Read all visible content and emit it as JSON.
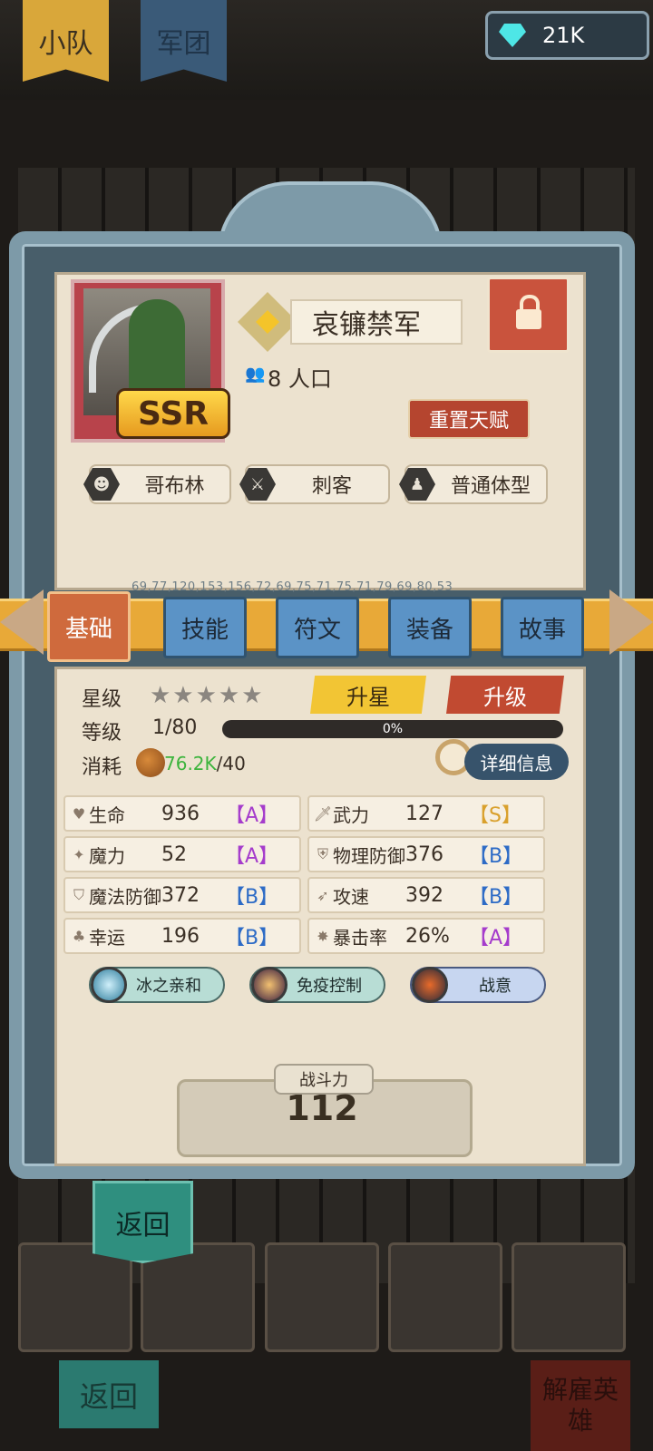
{
  "topbar": {
    "tabs": [
      {
        "label": "小队"
      },
      {
        "label": "军团"
      }
    ],
    "currency": {
      "icon": "diamond-icon",
      "amount": "21K"
    }
  },
  "hero": {
    "name": "哀镰禁军",
    "rarity": "SSR",
    "population": "8 人口",
    "reset_label": "重置天赋",
    "tags": [
      {
        "icon": "goblin-icon",
        "label": "哥布林"
      },
      {
        "icon": "crossed-swords-icon",
        "label": "刺客"
      },
      {
        "icon": "body-icon",
        "label": "普通体型"
      }
    ]
  },
  "faint_text": "69,77,120,153,156,72,69,75,71,75,71,79,69,80,53",
  "tabs": [
    {
      "label": "基础",
      "active": true
    },
    {
      "label": "技能"
    },
    {
      "label": "符文"
    },
    {
      "label": "装备"
    },
    {
      "label": "故事"
    }
  ],
  "basic": {
    "star_label": "星级",
    "stars": "★★★★★",
    "star_up_label": "升星",
    "level_up_label": "升级",
    "level_label": "等级",
    "level_value": "1/80",
    "xp_percent": "0%",
    "xp_fraction": 0,
    "cost_label": "消耗",
    "cost_have": "76.2K",
    "cost_need": "/40",
    "detail_label": "详细信息"
  },
  "stats": [
    {
      "icon": "heart-icon",
      "name": "生命",
      "value": "936",
      "grade": "【A】"
    },
    {
      "icon": "sword-icon",
      "name": "武力",
      "value": "127",
      "grade": "【S】"
    },
    {
      "icon": "magic-icon",
      "name": "魔力",
      "value": "52",
      "grade": "【A】"
    },
    {
      "icon": "shield-icon",
      "name": "物理防御",
      "value": "376",
      "grade": "【B】"
    },
    {
      "icon": "magic-shield-icon",
      "name": "魔法防御",
      "value": "372",
      "grade": "【B】"
    },
    {
      "icon": "boot-icon",
      "name": "攻速",
      "value": "392",
      "grade": "【B】"
    },
    {
      "icon": "clover-icon",
      "name": "幸运",
      "value": "196",
      "grade": "【B】"
    },
    {
      "icon": "burst-icon",
      "name": "暴击率",
      "value": "26%",
      "grade": "【A】"
    }
  ],
  "skills": [
    {
      "label": "冰之亲和",
      "icon": "ice-orb-icon"
    },
    {
      "label": "免疫控制",
      "icon": "immune-orb-icon"
    },
    {
      "label": "战意",
      "icon": "warrior-orb-icon"
    }
  ],
  "power": {
    "label": "战斗力",
    "value": "112"
  },
  "back_label": "返回",
  "bottom": {
    "back_label": "返回",
    "dismiss_label": "解雇英雄"
  },
  "colors": {
    "accent": "#e8a938",
    "active_tab": "#cf6a3d",
    "tab": "#5b93c6",
    "frame": "#7d9aa8"
  }
}
